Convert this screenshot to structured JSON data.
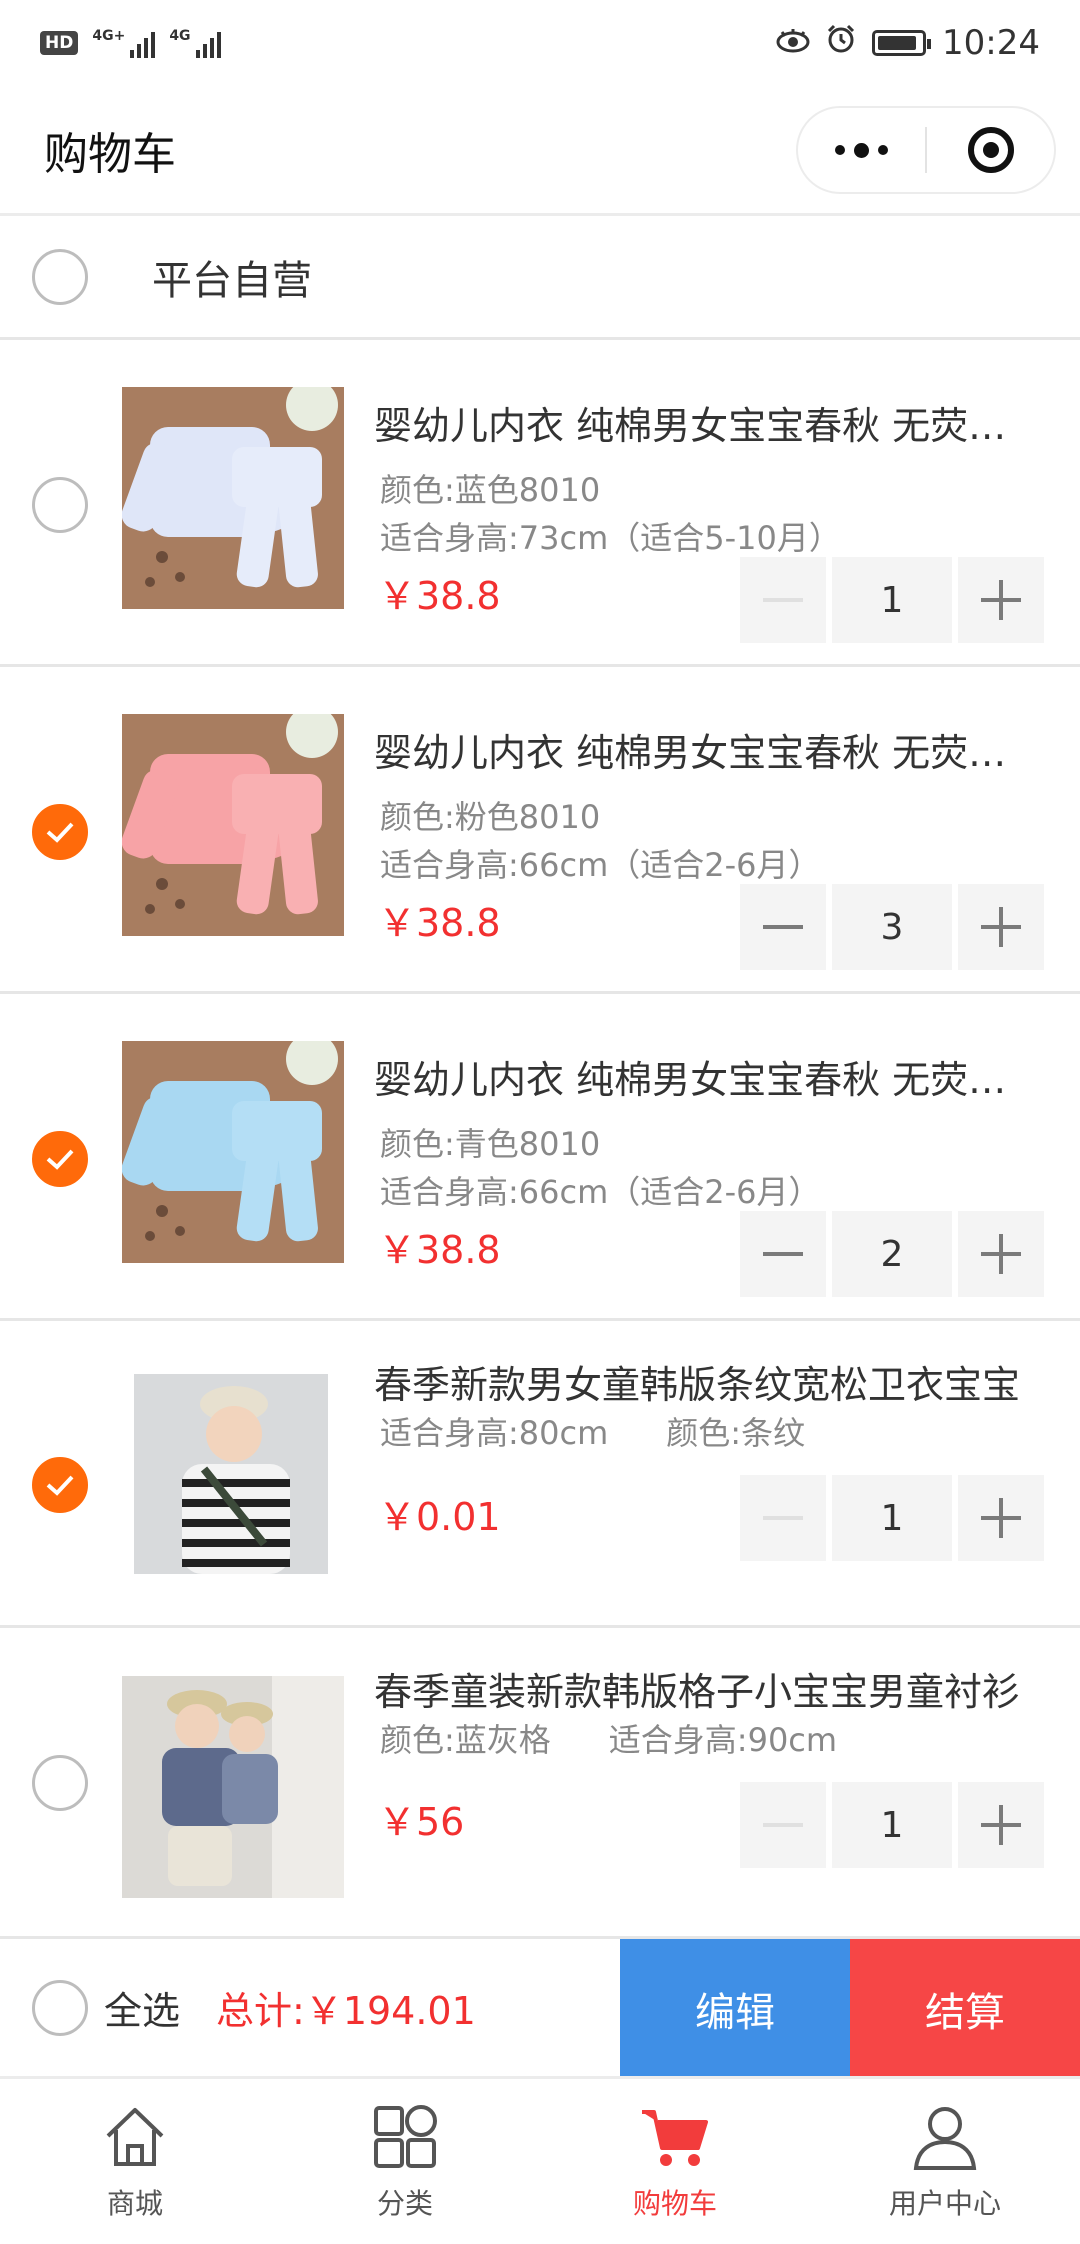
{
  "status_bar": {
    "hd": "HD",
    "network_1": "4G+",
    "network_2": "4G",
    "time": "10:24",
    "battery_level": 0.9
  },
  "header": {
    "title": "购物车"
  },
  "shop": {
    "name": "平台自营",
    "checked": false
  },
  "items": [
    {
      "checked": false,
      "title": "婴幼儿内衣 纯棉男女宝宝春秋 无荧光剂",
      "spec1": "颜色:蓝色8010",
      "spec2": "适合身高:73cm（适合5-10月）",
      "price": "￥38.8",
      "qty": "1",
      "minus_disabled": true,
      "image": "blue-pajama-set"
    },
    {
      "checked": true,
      "title": "婴幼儿内衣 纯棉男女宝宝春秋 无荧光剂",
      "spec1": "颜色:粉色8010",
      "spec2": "适合身高:66cm（适合2-6月）",
      "price": "￥38.8",
      "qty": "3",
      "minus_disabled": false,
      "image": "pink-pajama-set"
    },
    {
      "checked": true,
      "title": "婴幼儿内衣 纯棉男女宝宝春秋 无荧光剂",
      "spec1": "颜色:青色8010",
      "spec2": "适合身高:66cm（适合2-6月）",
      "price": "￥38.8",
      "qty": "2",
      "minus_disabled": false,
      "image": "cyan-pajama-set"
    },
    {
      "checked": true,
      "title": "春季新款男女童韩版条纹宽松卫衣宝宝",
      "spec1": "适合身高:80cm",
      "spec2": "颜色:条纹",
      "price": "￥0.01",
      "qty": "1",
      "minus_disabled": true,
      "image": "striped-sweatshirt-child"
    },
    {
      "checked": false,
      "title": "春季童装新款韩版格子小宝宝男童衬衫",
      "spec1": "颜色:蓝灰格",
      "spec2": "适合身高:90cm",
      "price": "￥56",
      "qty": "1",
      "minus_disabled": true,
      "image": "plaid-shirt-children"
    }
  ],
  "checkout": {
    "select_all": "全选",
    "total": "总计:￥194.01",
    "edit": "编辑",
    "submit": "结算"
  },
  "tabs": [
    {
      "label": "商城",
      "icon": "home-icon",
      "active": false
    },
    {
      "label": "分类",
      "icon": "category-icon",
      "active": false
    },
    {
      "label": "购物车",
      "icon": "cart-icon",
      "active": true
    },
    {
      "label": "用户中心",
      "icon": "user-icon",
      "active": false
    }
  ],
  "colors": {
    "accent_orange": "#ff6a0a",
    "price_red": "#f23030",
    "edit_blue": "#3f8fe6",
    "checkout_red": "#f64646"
  }
}
